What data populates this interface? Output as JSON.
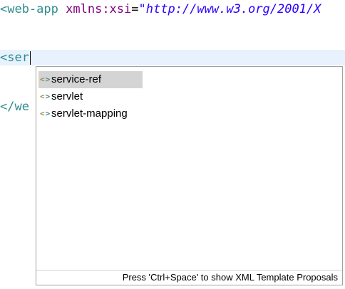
{
  "editor": {
    "line1": {
      "tag": "<web-app",
      "attr": "xmlns:xsi",
      "eq": "=",
      "value": "\"http://www.w3.org/2001/X"
    },
    "line2": {
      "text": "<ser"
    },
    "line3": {
      "text": "</we"
    }
  },
  "content_assist": {
    "proposals": [
      {
        "icon": "xml-element-icon",
        "label": "service-ref",
        "selected": true
      },
      {
        "icon": "xml-element-icon",
        "label": "servlet",
        "selected": false
      },
      {
        "icon": "xml-element-icon",
        "label": "servlet-mapping",
        "selected": false
      }
    ],
    "footer": "Press 'Ctrl+Space' to show XML Template Proposals"
  },
  "colors": {
    "tag": "#2f8d8d",
    "attribute": "#7f007f",
    "string": "#2a00ff",
    "current_line": "#e8f2fe",
    "selection": "#d4d4d4"
  }
}
